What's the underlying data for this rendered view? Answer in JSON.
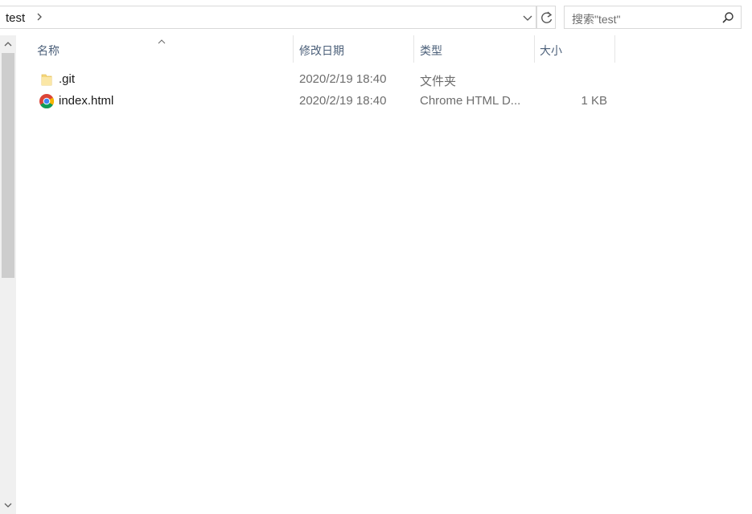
{
  "address": {
    "crumb": "test"
  },
  "search": {
    "placeholder": "搜索\"test\""
  },
  "columns": {
    "name": "名称",
    "date": "修改日期",
    "type": "类型",
    "size": "大小"
  },
  "files": [
    {
      "name": ".git",
      "date": "2020/2/19 18:40",
      "type": "文件夹",
      "size": "",
      "icon": "folder-icon"
    },
    {
      "name": "index.html",
      "date": "2020/2/19 18:40",
      "type": "Chrome HTML D...",
      "size": "1 KB",
      "icon": "chrome-icon"
    }
  ],
  "colors": {
    "header_text": "#4c607a",
    "folder": "#f5d77c",
    "scrollbar_thumb": "#cdcdcd"
  }
}
